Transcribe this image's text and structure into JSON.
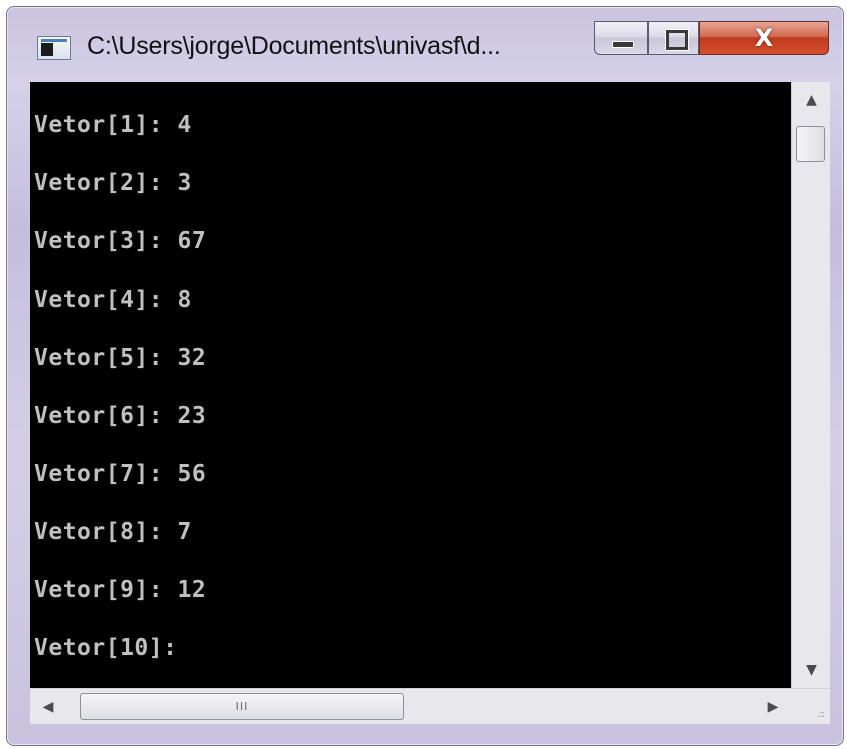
{
  "window": {
    "title": "C:\\Users\\jorge\\Documents\\univasf\\d...",
    "close_glyph": "X"
  },
  "console": {
    "lines": [
      "Vetor[1]: 4",
      "Vetor[2]: 3",
      "Vetor[3]: 67",
      "Vetor[4]: 8",
      "Vetor[5]: 32",
      "Vetor[6]: 23",
      "Vetor[7]: 56",
      "Vetor[8]: 7",
      "Vetor[9]: 12",
      "Vetor[10]:"
    ]
  },
  "scrollbars": {
    "up_arrow": "▲",
    "down_arrow": "▼",
    "left_arrow": "◀",
    "right_arrow": "▶",
    "thumb_grip": "III",
    "size_grip": ".::"
  },
  "colors": {
    "console_bg": "#000000",
    "console_text": "#c0c0c0",
    "close_button": "#c0391c"
  }
}
